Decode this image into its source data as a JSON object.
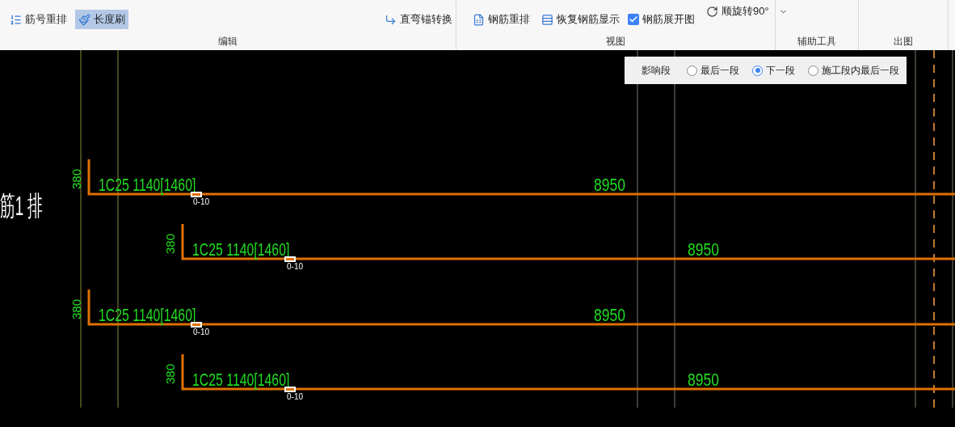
{
  "ribbon": {
    "groups": [
      {
        "label": "编辑",
        "items": [
          {
            "kind": "button",
            "label": "筋号重排",
            "selected": false
          },
          {
            "kind": "button",
            "label": "长度刷",
            "selected": true
          },
          {
            "kind": "button",
            "label": "直弯锚转换",
            "selected": false
          }
        ]
      },
      {
        "label": "视图",
        "items": [
          {
            "kind": "button",
            "label": "钢筋重排",
            "selected": false
          },
          {
            "kind": "button",
            "label": "恢复钢筋显示",
            "selected": false
          },
          {
            "kind": "checkbox",
            "label": "钢筋展开图",
            "checked": true
          },
          {
            "kind": "dropdown",
            "label": "顺旋转90°"
          }
        ]
      },
      {
        "label": "辅助工具"
      },
      {
        "label": "出图"
      }
    ]
  },
  "influence_panel": {
    "label": "影响段",
    "options": [
      {
        "label": "最后一段",
        "selected": false
      },
      {
        "label": "下一段",
        "selected": true
      },
      {
        "label": "施工段内最后一段",
        "selected": false
      }
    ]
  },
  "canvas": {
    "row_label": "筋1 排",
    "bars": [
      {
        "indent": false,
        "hook_mark": "380",
        "spec": "1C25 1140[1460]",
        "marker": "0-10",
        "length": "8950"
      },
      {
        "indent": true,
        "hook_mark": "380",
        "spec": "1C25 1140[1460]",
        "marker": "0-10",
        "length": "8950"
      },
      {
        "indent": false,
        "hook_mark": "380",
        "spec": "1C25 1140[1460]",
        "marker": "0-10",
        "length": "8950"
      },
      {
        "indent": true,
        "hook_mark": "380",
        "spec": "1C25 1140[1460]",
        "marker": "0-10",
        "length": "8950"
      }
    ]
  }
}
